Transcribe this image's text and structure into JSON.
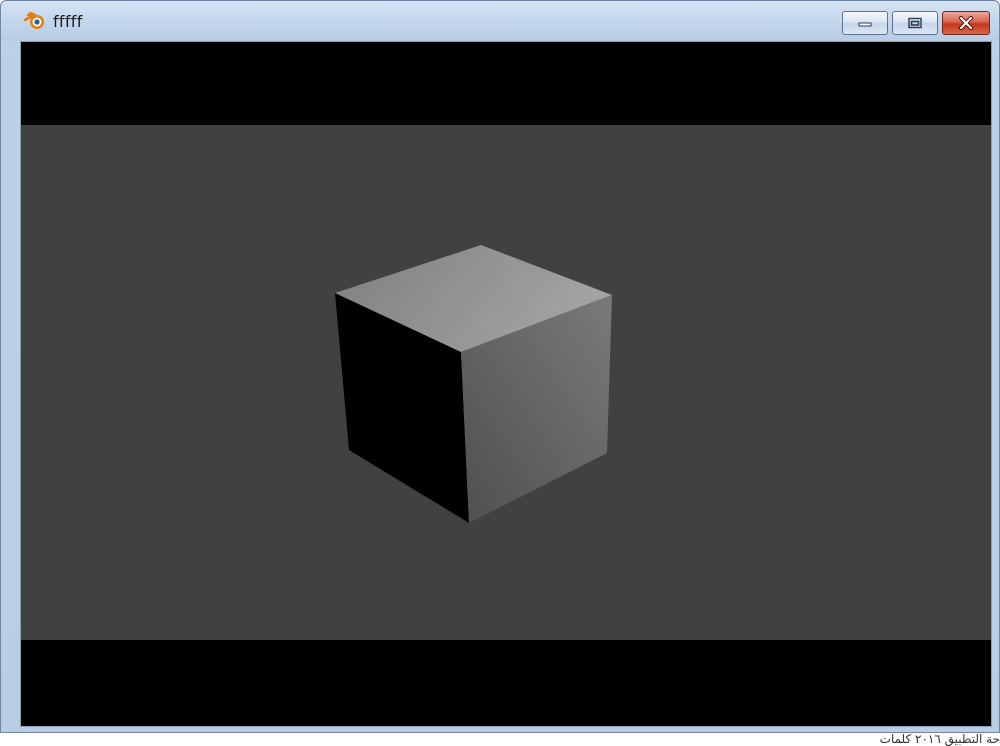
{
  "window": {
    "title": "fffff",
    "app_icon": "blender-icon",
    "controls": {
      "minimize_icon": "minimize-icon",
      "maximize_icon": "maximize-icon",
      "close_icon": "close-icon"
    }
  },
  "viewport": {
    "background_color": "#414141",
    "letterbox_color": "#000000",
    "object": "cube"
  },
  "colors": {
    "titlebar": "#c2d6ec",
    "close_button": "#c2381d"
  },
  "below_window_text": "حة التطبيق ٢٠١٦ كلمات"
}
